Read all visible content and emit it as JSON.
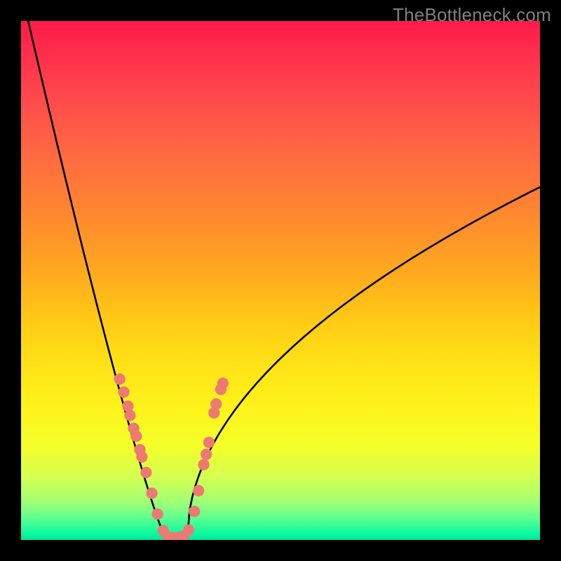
{
  "watermark": "TheBottleneck.com",
  "chart_data": {
    "type": "line",
    "title": "",
    "xlabel": "",
    "ylabel": "",
    "xlim": [
      0,
      100
    ],
    "ylim": [
      0,
      100
    ],
    "curve": {
      "name": "bottleneck-curve",
      "x_min": 28,
      "x_max": 32,
      "left_edge_y": 106,
      "right_edge_y": 68
    },
    "markers": {
      "name": "parametric-points",
      "color": "#ec7a73",
      "radius": 1.1,
      "points": [
        {
          "x": 19.0,
          "y": 31.0
        },
        {
          "x": 19.8,
          "y": 28.5
        },
        {
          "x": 20.6,
          "y": 25.8
        },
        {
          "x": 21.0,
          "y": 24.0
        },
        {
          "x": 21.7,
          "y": 21.5
        },
        {
          "x": 22.2,
          "y": 20.0
        },
        {
          "x": 22.9,
          "y": 17.4
        },
        {
          "x": 23.3,
          "y": 16.0
        },
        {
          "x": 24.1,
          "y": 13.0
        },
        {
          "x": 25.2,
          "y": 9.0
        },
        {
          "x": 26.3,
          "y": 5.0
        },
        {
          "x": 27.4,
          "y": 1.8
        },
        {
          "x": 28.3,
          "y": 0.6
        },
        {
          "x": 29.0,
          "y": 0.4
        },
        {
          "x": 29.7,
          "y": 0.4
        },
        {
          "x": 30.5,
          "y": 0.5
        },
        {
          "x": 31.3,
          "y": 0.7
        },
        {
          "x": 32.3,
          "y": 1.9
        },
        {
          "x": 33.4,
          "y": 5.5
        },
        {
          "x": 34.2,
          "y": 9.5
        },
        {
          "x": 35.2,
          "y": 14.5
        },
        {
          "x": 35.7,
          "y": 16.5
        },
        {
          "x": 36.2,
          "y": 18.8
        },
        {
          "x": 37.2,
          "y": 24.5
        },
        {
          "x": 37.6,
          "y": 26.2
        },
        {
          "x": 38.5,
          "y": 29.0
        },
        {
          "x": 38.9,
          "y": 30.2
        }
      ]
    },
    "gradient_stops": [
      {
        "pos": 0,
        "color": "#ff1a4a"
      },
      {
        "pos": 15,
        "color": "#ff4a4c"
      },
      {
        "pos": 38,
        "color": "#ff8a2e"
      },
      {
        "pos": 58,
        "color": "#ffcb15"
      },
      {
        "pos": 74,
        "color": "#fff21a"
      },
      {
        "pos": 93,
        "color": "#9cff78"
      },
      {
        "pos": 100,
        "color": "#02e59a"
      }
    ]
  }
}
